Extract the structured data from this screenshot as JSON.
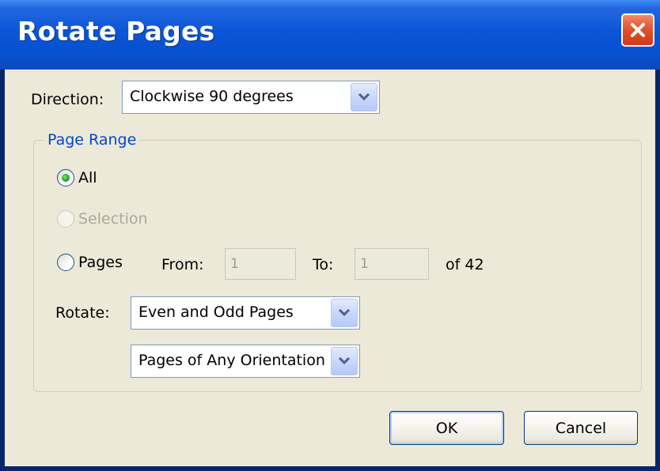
{
  "window": {
    "title": "Rotate Pages"
  },
  "direction": {
    "label": "Direction:",
    "value": "Clockwise 90 degrees"
  },
  "page_range": {
    "legend": "Page Range",
    "all_label": "All",
    "selection_label": "Selection",
    "pages_label": "Pages",
    "from_label": "From:",
    "from_value": "1",
    "to_label": "To:",
    "to_value": "1",
    "of_total": "of 42",
    "rotate_label": "Rotate:",
    "rotate_parity_value": "Even and Odd Pages",
    "rotate_orientation_value": "Pages of Any Orientation",
    "selected_option": "All"
  },
  "buttons": {
    "ok": "OK",
    "cancel": "Cancel"
  },
  "icons": {
    "close": "close-icon",
    "dropdown": "chevron-down-icon",
    "radio_selected": "radio-selected-icon"
  },
  "colors": {
    "titlebar": "#0a56d8",
    "dialog_bg": "#ece9d8",
    "group_legend": "#0046d5",
    "close_button": "#e4542c",
    "radio_dot": "#21a121"
  }
}
